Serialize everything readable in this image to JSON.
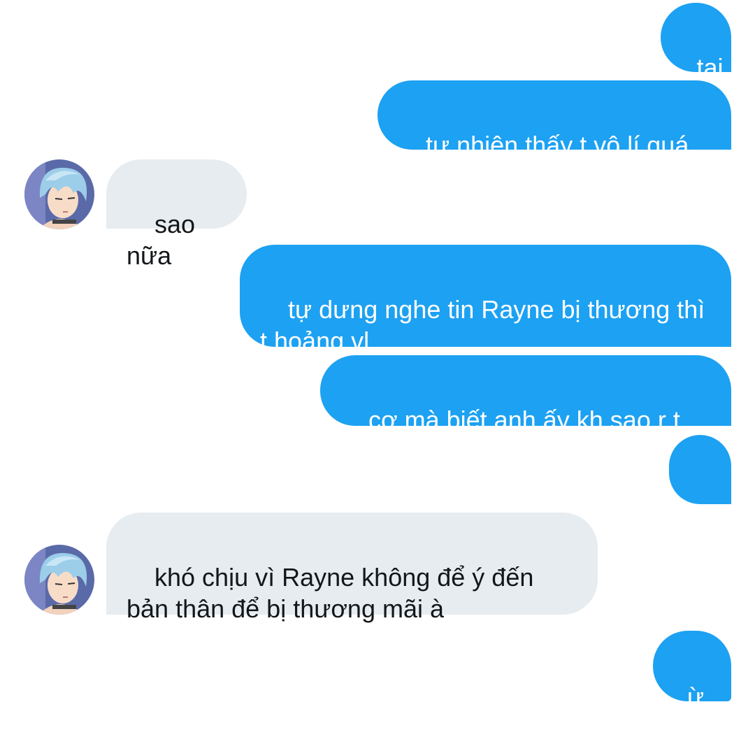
{
  "messages": [
    {
      "id": "m1",
      "sender": "me",
      "text": "tại"
    },
    {
      "id": "m2",
      "sender": "me",
      "text": "tự nhiên thấy t vô lí quá th"
    },
    {
      "id": "m3",
      "sender": "other",
      "text": "sao nữa"
    },
    {
      "id": "m4",
      "sender": "me",
      "text": "tự dưng nghe tin Rayne bị thương thì t hoảng vl"
    },
    {
      "id": "m5",
      "sender": "me",
      "text": "cơ mà biết anh ấy kh sao r t lại"
    },
    {
      "id": "m6",
      "sender": "me",
      "text": "..."
    },
    {
      "id": "m7",
      "sender": "other",
      "text": "khó chịu vì Rayne không để ý đến bản thân để bị thương mãi à"
    },
    {
      "id": "m8",
      "sender": "me",
      "text": "ừ..."
    }
  ],
  "colors": {
    "outgoing_bubble": "#1da1f2",
    "outgoing_text": "#ffffff",
    "incoming_bubble": "#e6ecf0",
    "incoming_text": "#14171a",
    "background": "#ffffff"
  },
  "avatar": {
    "icon": "anime-avatar-icon",
    "hair_color": "#8fc6e4"
  }
}
